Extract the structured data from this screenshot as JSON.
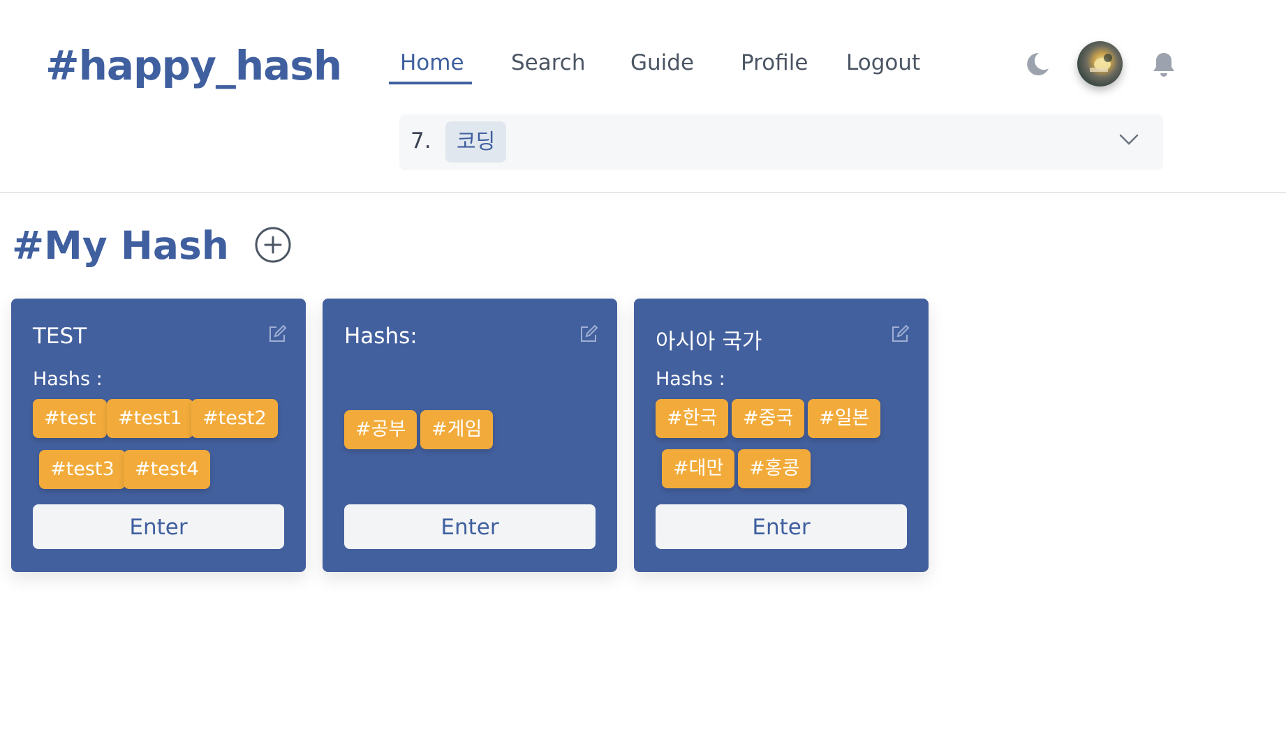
{
  "header": {
    "brand": "#happy_hash",
    "nav": {
      "home": "Home",
      "search": "Search",
      "guide": "Guide",
      "profile": "Profile",
      "logout": "Logout"
    },
    "icons": {
      "theme": "moon-icon",
      "avatar": "avatar",
      "notifications": "bell-icon"
    },
    "selector": {
      "number": "7.",
      "selected": "코딩"
    }
  },
  "main": {
    "title": "#My Hash",
    "cards": [
      {
        "title": "TEST",
        "hashs_label": "Hashs :",
        "tags": [
          "#test",
          "#test1",
          "#test2",
          "#test3",
          "#test4"
        ],
        "enter": "Enter"
      },
      {
        "title": "Hashs:",
        "hashs_label": "",
        "tags": [
          "#공부",
          "#게임"
        ],
        "enter": "Enter"
      },
      {
        "title": "아시아 국가",
        "hashs_label": "Hashs :",
        "tags": [
          "#한국",
          "#중국",
          "#일본",
          "#대만",
          "#홍콩"
        ],
        "enter": "Enter"
      }
    ]
  },
  "colors": {
    "primary": "#43609e",
    "brand_text": "#3f5f9f",
    "tag": "#f2ab3a",
    "button_bg": "#f3f4f6"
  }
}
